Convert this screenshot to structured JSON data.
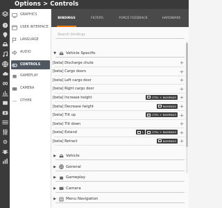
{
  "titlebar": {
    "title": "Options > Controls"
  },
  "rail_icons": [
    "layers-icon",
    "help-icon",
    "map-pin-icon",
    "car-icon",
    "music-icon",
    "globe-icon",
    "cloud-icon",
    "infinity-icon",
    "chart-icon",
    "box-icon",
    "camera-icon",
    "list-icon",
    "sliders-icon",
    "gear-icon",
    "bug-icon",
    "bar-chart-icon"
  ],
  "nav": {
    "items": [
      {
        "label": "GRAPHICS",
        "icon": "monitor-icon"
      },
      {
        "label": "USER INTERFACE",
        "icon": "window-icon"
      },
      {
        "label": "LANGUAGE",
        "icon": "flag-icon"
      },
      {
        "label": "AUDIO",
        "icon": "speaker-icon"
      },
      {
        "label": "CONTROLS",
        "icon": "gamepad-icon",
        "active": true
      },
      {
        "label": "GAMEPLAY",
        "icon": "puzzle-icon"
      },
      {
        "label": "CAMERA",
        "icon": "camera-icon"
      },
      {
        "label": "OTHER",
        "icon": "dots-icon"
      }
    ]
  },
  "tabs": [
    {
      "label": "BINDINGS",
      "active": true
    },
    {
      "label": "FILTERS"
    },
    {
      "label": "FORCE FEEDBACK"
    },
    {
      "label": "HARDWARE"
    }
  ],
  "search": {
    "placeholder": "Search bindings"
  },
  "vehicle_specific": {
    "title": "Vehicle Specific",
    "bindings": [
      {
        "label": "[beta] Discharge chute",
        "keys": []
      },
      {
        "label": "[beta] Cargo doors",
        "keys": []
      },
      {
        "label": "[beta] Left cargo door",
        "keys": []
      },
      {
        "label": "[beta] Right cargo door",
        "keys": []
      },
      {
        "label": "[beta] Increase height",
        "keys": [
          "CTRL + NUMPAD5"
        ]
      },
      {
        "label": "[beta] Decrease height",
        "keys": [
          "NUMPAD5"
        ]
      },
      {
        "label": "[beta] Tilt up",
        "keys": [
          "CTRL + NUMPAD3"
        ]
      },
      {
        "label": "[beta] Tilt down",
        "keys": []
      },
      {
        "label": "[beta] Extend",
        "keys": [
          "1",
          "CTRL + NUMPAD3"
        ]
      },
      {
        "label": "[beta] Retract",
        "keys": [
          "NUMPAD3"
        ]
      }
    ]
  },
  "groups": [
    {
      "title": "Vehicle",
      "icon": "car-icon"
    },
    {
      "title": "General",
      "icon": "globe-icon"
    },
    {
      "title": "Gameplay",
      "icon": "puzzle-icon"
    },
    {
      "title": "Camera",
      "icon": "camera-icon"
    },
    {
      "title": "Menu Navigation",
      "icon": "menu-icon"
    }
  ],
  "colors": {
    "accent": "#ff7a00",
    "active_nav": "#4f5860",
    "titlebar": "#3a3a3a"
  }
}
